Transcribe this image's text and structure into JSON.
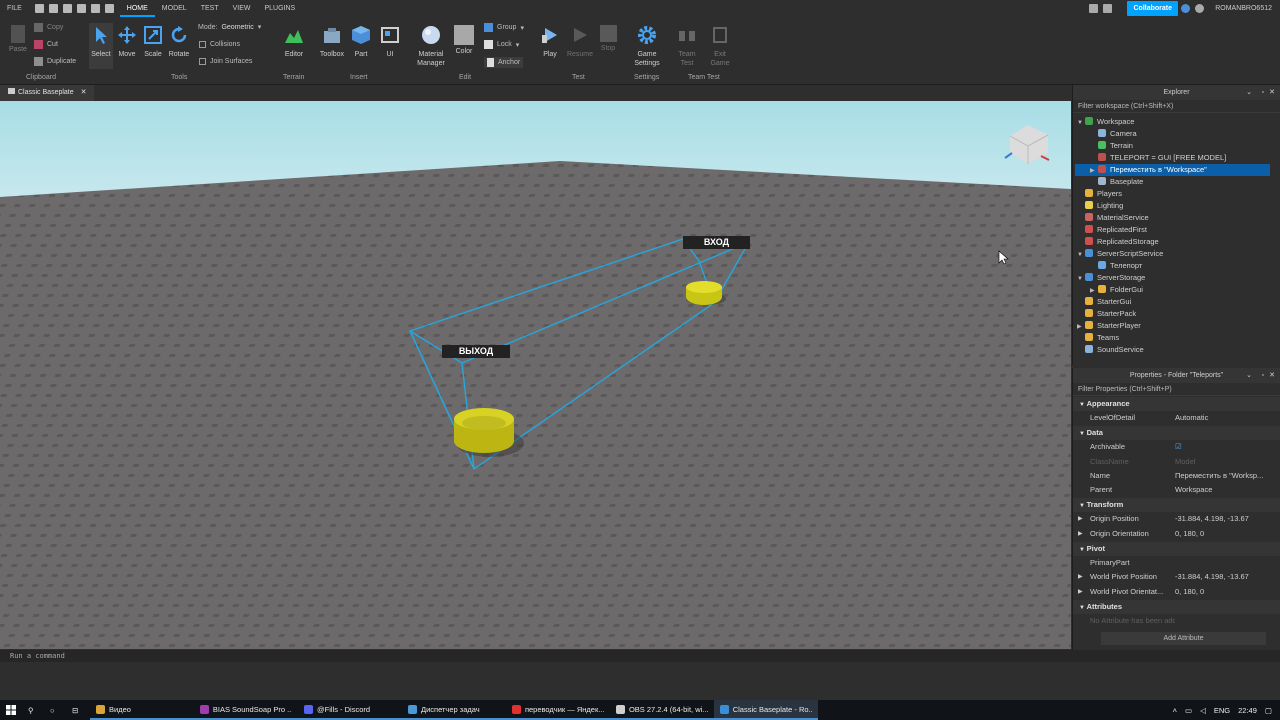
{
  "menu": {
    "tabs": [
      "FILE",
      "HOME",
      "MODEL",
      "TEST",
      "VIEW",
      "PLUGINS"
    ],
    "active_tab": "HOME"
  },
  "header": {
    "collaborate_label": "Collaborate",
    "username": "ROMANBRO6512"
  },
  "ribbon": {
    "clipboard": {
      "paste": "Paste",
      "copy": "Copy",
      "cut": "Cut",
      "duplicate": "Duplicate",
      "group": "Clipboard"
    },
    "tools": {
      "select": "Select",
      "move": "Move",
      "scale": "Scale",
      "rotate": "Rotate",
      "mode_label": "Mode:",
      "mode_value": "Geometric",
      "collisions": "Collisions",
      "join_surfaces": "Join Surfaces",
      "group": "Tools"
    },
    "terrain": {
      "editor": "Editor",
      "group": "Terrain"
    },
    "insert": {
      "toolbox": "Toolbox",
      "part": "Part",
      "ui": "UI",
      "group": "Insert"
    },
    "edit": {
      "material_manager_1": "Material",
      "material_manager_2": "Manager",
      "color": "Color",
      "group_label": "Group",
      "lock": "Lock",
      "anchor": "Anchor",
      "group": "Edit"
    },
    "test": {
      "play": "Play",
      "resume": "Resume",
      "stop": "Stop",
      "group": "Test"
    },
    "settings": {
      "game_settings_1": "Game",
      "game_settings_2": "Settings",
      "group": "Settings"
    },
    "team_test": {
      "team_test_1": "Team",
      "team_test_2": "Test",
      "exit_game_1": "Exit",
      "exit_game_2": "Game",
      "group": "Team Test"
    }
  },
  "viewport": {
    "tab_label": "Classic Baseplate",
    "billboard_entry": "ВХОД",
    "billboard_exit": "ВЫХОД"
  },
  "explorer": {
    "title": "Explorer",
    "filter": "Filter workspace (Ctrl+Shift+X)",
    "items": [
      {
        "label": "Workspace",
        "depth": 0,
        "expander": "▼",
        "icon": "#3fa34d"
      },
      {
        "label": "Camera",
        "depth": 1,
        "expander": "",
        "icon": "#8ab4d8"
      },
      {
        "label": "Terrain",
        "depth": 1,
        "expander": "",
        "icon": "#4bbf5f"
      },
      {
        "label": "TELEPORT = GUI [FREE MODEL]",
        "depth": 1,
        "expander": "",
        "icon": "#c0504d"
      },
      {
        "label": "Переместить в \"Workspace\"",
        "depth": 1,
        "expander": "▶",
        "icon": "#c0504d",
        "selected": true
      },
      {
        "label": "Baseplate",
        "depth": 1,
        "expander": "",
        "icon": "#9fb6cd"
      },
      {
        "label": "Players",
        "depth": 0,
        "expander": "",
        "icon": "#e6b13c"
      },
      {
        "label": "Lighting",
        "depth": 0,
        "expander": "",
        "icon": "#e8d24a"
      },
      {
        "label": "MaterialService",
        "depth": 0,
        "expander": "",
        "icon": "#c86464"
      },
      {
        "label": "ReplicatedFirst",
        "depth": 0,
        "expander": "",
        "icon": "#d05050"
      },
      {
        "label": "ReplicatedStorage",
        "depth": 0,
        "expander": "",
        "icon": "#d05050"
      },
      {
        "label": "ServerScriptService",
        "depth": 0,
        "expander": "▼",
        "icon": "#4a90d9"
      },
      {
        "label": "Телепорт",
        "depth": 1,
        "expander": "",
        "icon": "#6aa8e6"
      },
      {
        "label": "ServerStorage",
        "depth": 0,
        "expander": "▼",
        "icon": "#4a90d9"
      },
      {
        "label": "FolderGui",
        "depth": 1,
        "expander": "▶",
        "icon": "#e6b13c"
      },
      {
        "label": "StarterGui",
        "depth": 0,
        "expander": "",
        "icon": "#e6b13c"
      },
      {
        "label": "StarterPack",
        "depth": 0,
        "expander": "",
        "icon": "#e6b13c"
      },
      {
        "label": "StarterPlayer",
        "depth": 0,
        "expander": "▶",
        "icon": "#e6b13c"
      },
      {
        "label": "Teams",
        "depth": 0,
        "expander": "",
        "icon": "#e6b13c"
      },
      {
        "label": "SoundService",
        "depth": 0,
        "expander": "",
        "icon": "#8ab4d8"
      }
    ]
  },
  "properties": {
    "title": "Properties - Folder \"Teleports\"",
    "filter": "Filter Properties (Ctrl+Shift+P)",
    "sections": [
      {
        "name": "Appearance",
        "rows": [
          {
            "name": "LevelOfDetail",
            "value": "Automatic"
          }
        ]
      },
      {
        "name": "Data",
        "rows": [
          {
            "name": "Archivable",
            "value": "☑"
          },
          {
            "name": "ClassName",
            "value": "Model",
            "dim": true
          },
          {
            "name": "Name",
            "value": "Переместить в \"Worksp..."
          },
          {
            "name": "Parent",
            "value": "Workspace"
          }
        ]
      },
      {
        "name": "Transform",
        "rows": [
          {
            "name": "Origin Position",
            "value": "-31.884, 4.198, -13.67",
            "expander": "▶"
          },
          {
            "name": "Origin Orientation",
            "value": "0, 180, 0",
            "expander": "▶"
          }
        ]
      },
      {
        "name": "Pivot",
        "rows": [
          {
            "name": "PrimaryPart",
            "value": ""
          },
          {
            "name": "World Pivot Position",
            "value": "-31.884, 4.198, -13.67",
            "expander": "▶"
          },
          {
            "name": "World Pivot Orientat...",
            "value": "0, 180, 0",
            "expander": "▶"
          }
        ]
      },
      {
        "name": "Attributes",
        "rows": [
          {
            "name": "No Attribute has been added yet",
            "value": "",
            "dim": true
          }
        ]
      }
    ],
    "add_attribute": "Add Attribute"
  },
  "command_bar": {
    "placeholder": "Run a command"
  },
  "taskbar": {
    "apps": [
      {
        "label": "Видео",
        "icon": "#d9a536"
      },
      {
        "label": "BIAS SoundSoap Pro ...",
        "icon": "#a03cb0"
      },
      {
        "label": "@Fills - Discord",
        "icon": "#5865f2"
      },
      {
        "label": "Диспетчер задач",
        "icon": "#4a9ad9"
      },
      {
        "label": "переводчик — Яндек...",
        "icon": "#e03030"
      },
      {
        "label": "OBS 27.2.4 (64-bit, wi...",
        "icon": "#cfcfcf"
      },
      {
        "label": "Classic Baseplate - Ro...",
        "icon": "#3a8fd8"
      }
    ],
    "lang": "ENG",
    "time": "22:49"
  }
}
